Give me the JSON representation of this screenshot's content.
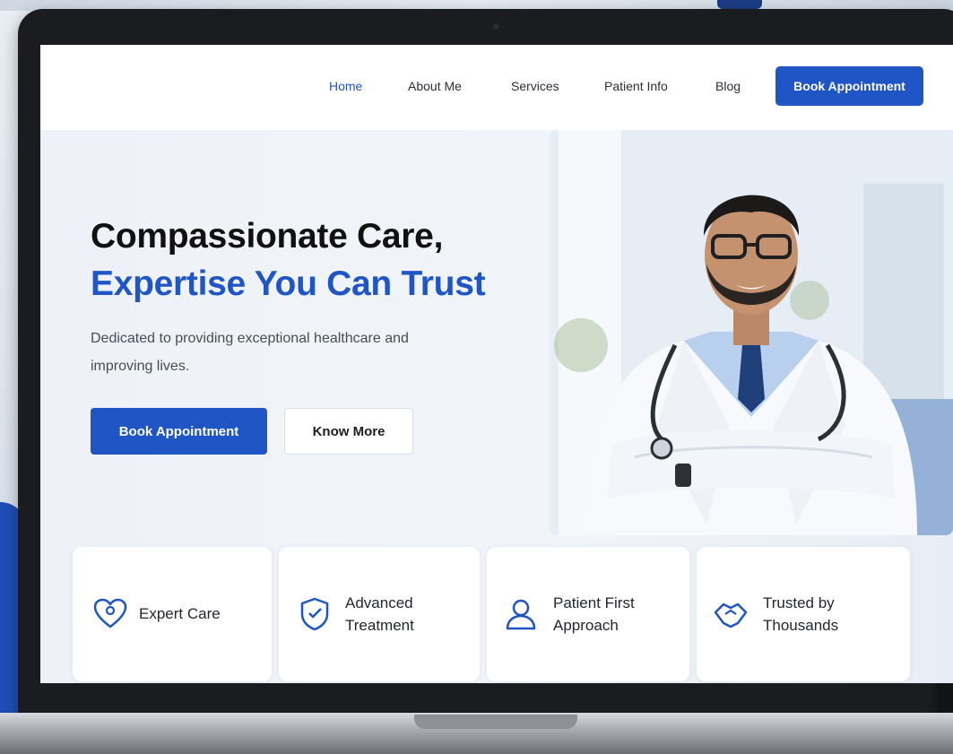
{
  "nav": {
    "links": [
      {
        "label": "Home",
        "active": true
      },
      {
        "label": "About Me",
        "active": false
      },
      {
        "label": "Services",
        "active": false
      },
      {
        "label": "Patient Info",
        "active": false
      },
      {
        "label": "Blog",
        "active": false
      }
    ],
    "cta_label": "Book Appointment"
  },
  "hero": {
    "headline_line1": "Compassionate Care,",
    "headline_line2": "Expertise You Can Trust",
    "subtext": "Dedicated to providing exceptional healthcare and improving lives.",
    "primary_button": "Book Appointment",
    "secondary_button": "Know More",
    "photo_subject": "smiling doctor in white coat with stethoscope, arms crossed"
  },
  "features": [
    {
      "icon": "heart-icon",
      "label": "Expert Care"
    },
    {
      "icon": "medical-shield-icon",
      "label": "Advanced Treatment"
    },
    {
      "icon": "patient-icon",
      "label": "Patient First Approach"
    },
    {
      "icon": "handshake-icon",
      "label": "Trusted by Thousands"
    }
  ],
  "colors": {
    "accent": "#1f55c4",
    "heading": "#111111",
    "body_text": "#474d57",
    "hero_bg": "#eef2f8",
    "nav_bg": "#ffffff"
  }
}
